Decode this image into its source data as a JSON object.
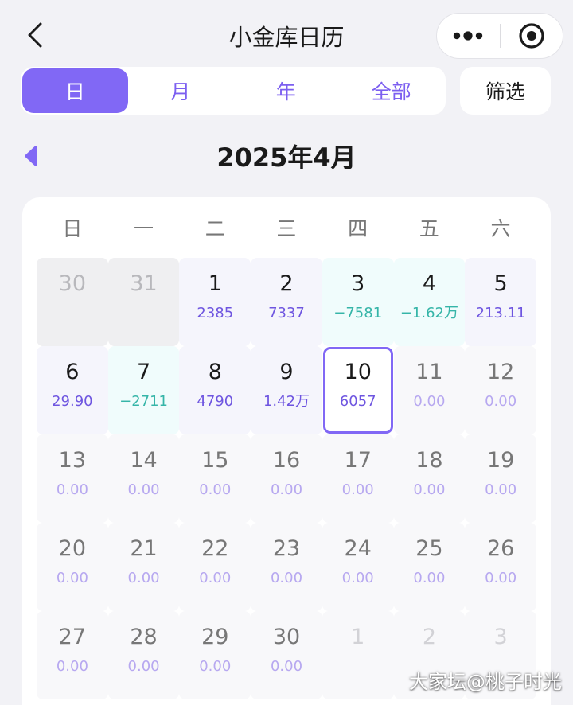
{
  "header": {
    "title": "小金库日历"
  },
  "tabs": [
    "日",
    "月",
    "年",
    "全部"
  ],
  "filter_label": "筛选",
  "month_title": "2025年4月",
  "weekdays": [
    "日",
    "一",
    "二",
    "三",
    "四",
    "五",
    "六"
  ],
  "colors": {
    "accent": "#8168f5",
    "income_text": "#6e55e0",
    "expense_text": "#35b5a8",
    "muted_amount": "#b7a8f0"
  },
  "days": [
    {
      "day": "30",
      "amount": "",
      "kind": "prev"
    },
    {
      "day": "31",
      "amount": "",
      "kind": "prev"
    },
    {
      "day": "1",
      "amount": "2385",
      "kind": "income"
    },
    {
      "day": "2",
      "amount": "7337",
      "kind": "income"
    },
    {
      "day": "3",
      "amount": "−7581",
      "kind": "expense"
    },
    {
      "day": "4",
      "amount": "−1.62万",
      "kind": "expense"
    },
    {
      "day": "5",
      "amount": "213.11",
      "kind": "income"
    },
    {
      "day": "6",
      "amount": "29.90",
      "kind": "income"
    },
    {
      "day": "7",
      "amount": "−2711",
      "kind": "expense"
    },
    {
      "day": "8",
      "amount": "4790",
      "kind": "income"
    },
    {
      "day": "9",
      "amount": "1.42万",
      "kind": "income"
    },
    {
      "day": "10",
      "amount": "6057",
      "kind": "selected"
    },
    {
      "day": "11",
      "amount": "0.00",
      "kind": "future"
    },
    {
      "day": "12",
      "amount": "0.00",
      "kind": "future"
    },
    {
      "day": "13",
      "amount": "0.00",
      "kind": "future"
    },
    {
      "day": "14",
      "amount": "0.00",
      "kind": "future"
    },
    {
      "day": "15",
      "amount": "0.00",
      "kind": "future"
    },
    {
      "day": "16",
      "amount": "0.00",
      "kind": "future"
    },
    {
      "day": "17",
      "amount": "0.00",
      "kind": "future"
    },
    {
      "day": "18",
      "amount": "0.00",
      "kind": "future"
    },
    {
      "day": "19",
      "amount": "0.00",
      "kind": "future"
    },
    {
      "day": "20",
      "amount": "0.00",
      "kind": "future"
    },
    {
      "day": "21",
      "amount": "0.00",
      "kind": "future"
    },
    {
      "day": "22",
      "amount": "0.00",
      "kind": "future"
    },
    {
      "day": "23",
      "amount": "0.00",
      "kind": "future"
    },
    {
      "day": "24",
      "amount": "0.00",
      "kind": "future"
    },
    {
      "day": "25",
      "amount": "0.00",
      "kind": "future"
    },
    {
      "day": "26",
      "amount": "0.00",
      "kind": "future"
    },
    {
      "day": "27",
      "amount": "0.00",
      "kind": "future"
    },
    {
      "day": "28",
      "amount": "0.00",
      "kind": "future"
    },
    {
      "day": "29",
      "amount": "0.00",
      "kind": "future"
    },
    {
      "day": "30",
      "amount": "0.00",
      "kind": "future"
    },
    {
      "day": "1",
      "amount": "",
      "kind": "next"
    },
    {
      "day": "2",
      "amount": "",
      "kind": "next"
    },
    {
      "day": "3",
      "amount": "",
      "kind": "next"
    }
  ],
  "watermark": "大家坛@桃子时光"
}
